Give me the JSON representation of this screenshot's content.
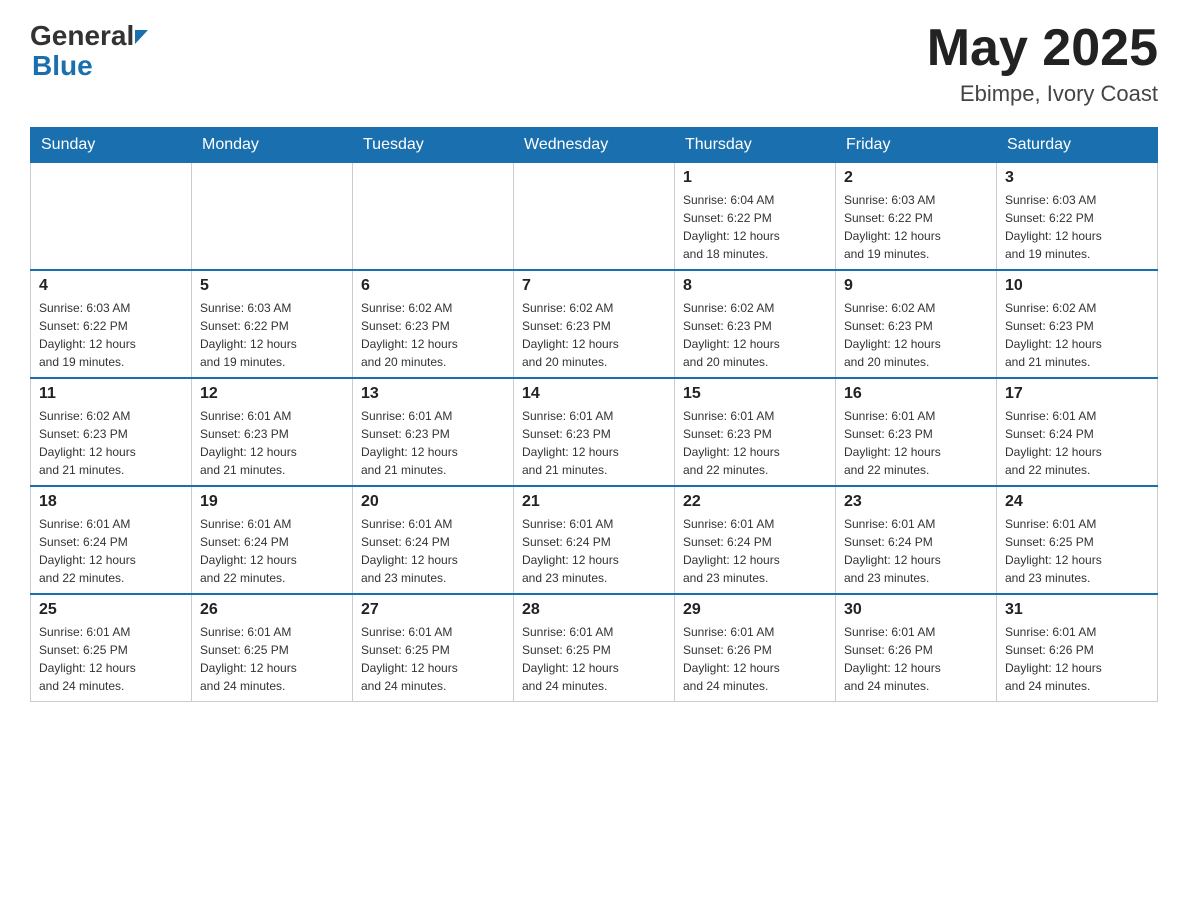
{
  "header": {
    "logo_general": "General",
    "logo_blue": "Blue",
    "month_year": "May 2025",
    "location": "Ebimpe, Ivory Coast"
  },
  "days_of_week": [
    "Sunday",
    "Monday",
    "Tuesday",
    "Wednesday",
    "Thursday",
    "Friday",
    "Saturday"
  ],
  "weeks": [
    [
      {
        "day": "",
        "info": ""
      },
      {
        "day": "",
        "info": ""
      },
      {
        "day": "",
        "info": ""
      },
      {
        "day": "",
        "info": ""
      },
      {
        "day": "1",
        "info": "Sunrise: 6:04 AM\nSunset: 6:22 PM\nDaylight: 12 hours\nand 18 minutes."
      },
      {
        "day": "2",
        "info": "Sunrise: 6:03 AM\nSunset: 6:22 PM\nDaylight: 12 hours\nand 19 minutes."
      },
      {
        "day": "3",
        "info": "Sunrise: 6:03 AM\nSunset: 6:22 PM\nDaylight: 12 hours\nand 19 minutes."
      }
    ],
    [
      {
        "day": "4",
        "info": "Sunrise: 6:03 AM\nSunset: 6:22 PM\nDaylight: 12 hours\nand 19 minutes."
      },
      {
        "day": "5",
        "info": "Sunrise: 6:03 AM\nSunset: 6:22 PM\nDaylight: 12 hours\nand 19 minutes."
      },
      {
        "day": "6",
        "info": "Sunrise: 6:02 AM\nSunset: 6:23 PM\nDaylight: 12 hours\nand 20 minutes."
      },
      {
        "day": "7",
        "info": "Sunrise: 6:02 AM\nSunset: 6:23 PM\nDaylight: 12 hours\nand 20 minutes."
      },
      {
        "day": "8",
        "info": "Sunrise: 6:02 AM\nSunset: 6:23 PM\nDaylight: 12 hours\nand 20 minutes."
      },
      {
        "day": "9",
        "info": "Sunrise: 6:02 AM\nSunset: 6:23 PM\nDaylight: 12 hours\nand 20 minutes."
      },
      {
        "day": "10",
        "info": "Sunrise: 6:02 AM\nSunset: 6:23 PM\nDaylight: 12 hours\nand 21 minutes."
      }
    ],
    [
      {
        "day": "11",
        "info": "Sunrise: 6:02 AM\nSunset: 6:23 PM\nDaylight: 12 hours\nand 21 minutes."
      },
      {
        "day": "12",
        "info": "Sunrise: 6:01 AM\nSunset: 6:23 PM\nDaylight: 12 hours\nand 21 minutes."
      },
      {
        "day": "13",
        "info": "Sunrise: 6:01 AM\nSunset: 6:23 PM\nDaylight: 12 hours\nand 21 minutes."
      },
      {
        "day": "14",
        "info": "Sunrise: 6:01 AM\nSunset: 6:23 PM\nDaylight: 12 hours\nand 21 minutes."
      },
      {
        "day": "15",
        "info": "Sunrise: 6:01 AM\nSunset: 6:23 PM\nDaylight: 12 hours\nand 22 minutes."
      },
      {
        "day": "16",
        "info": "Sunrise: 6:01 AM\nSunset: 6:23 PM\nDaylight: 12 hours\nand 22 minutes."
      },
      {
        "day": "17",
        "info": "Sunrise: 6:01 AM\nSunset: 6:24 PM\nDaylight: 12 hours\nand 22 minutes."
      }
    ],
    [
      {
        "day": "18",
        "info": "Sunrise: 6:01 AM\nSunset: 6:24 PM\nDaylight: 12 hours\nand 22 minutes."
      },
      {
        "day": "19",
        "info": "Sunrise: 6:01 AM\nSunset: 6:24 PM\nDaylight: 12 hours\nand 22 minutes."
      },
      {
        "day": "20",
        "info": "Sunrise: 6:01 AM\nSunset: 6:24 PM\nDaylight: 12 hours\nand 23 minutes."
      },
      {
        "day": "21",
        "info": "Sunrise: 6:01 AM\nSunset: 6:24 PM\nDaylight: 12 hours\nand 23 minutes."
      },
      {
        "day": "22",
        "info": "Sunrise: 6:01 AM\nSunset: 6:24 PM\nDaylight: 12 hours\nand 23 minutes."
      },
      {
        "day": "23",
        "info": "Sunrise: 6:01 AM\nSunset: 6:24 PM\nDaylight: 12 hours\nand 23 minutes."
      },
      {
        "day": "24",
        "info": "Sunrise: 6:01 AM\nSunset: 6:25 PM\nDaylight: 12 hours\nand 23 minutes."
      }
    ],
    [
      {
        "day": "25",
        "info": "Sunrise: 6:01 AM\nSunset: 6:25 PM\nDaylight: 12 hours\nand 24 minutes."
      },
      {
        "day": "26",
        "info": "Sunrise: 6:01 AM\nSunset: 6:25 PM\nDaylight: 12 hours\nand 24 minutes."
      },
      {
        "day": "27",
        "info": "Sunrise: 6:01 AM\nSunset: 6:25 PM\nDaylight: 12 hours\nand 24 minutes."
      },
      {
        "day": "28",
        "info": "Sunrise: 6:01 AM\nSunset: 6:25 PM\nDaylight: 12 hours\nand 24 minutes."
      },
      {
        "day": "29",
        "info": "Sunrise: 6:01 AM\nSunset: 6:26 PM\nDaylight: 12 hours\nand 24 minutes."
      },
      {
        "day": "30",
        "info": "Sunrise: 6:01 AM\nSunset: 6:26 PM\nDaylight: 12 hours\nand 24 minutes."
      },
      {
        "day": "31",
        "info": "Sunrise: 6:01 AM\nSunset: 6:26 PM\nDaylight: 12 hours\nand 24 minutes."
      }
    ]
  ]
}
